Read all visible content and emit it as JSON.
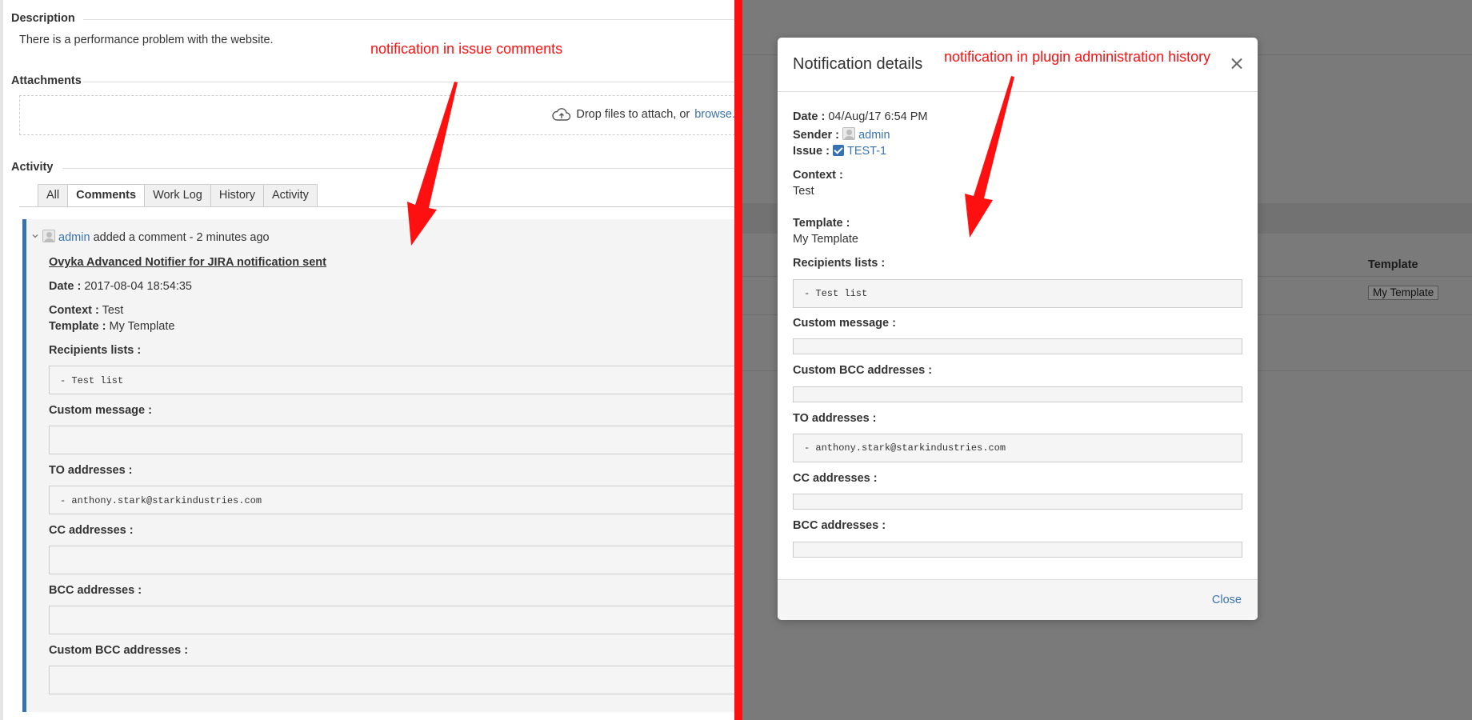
{
  "left_pane": {
    "description": {
      "heading": "Description",
      "text": "There is a performance problem with the website."
    },
    "attachments": {
      "heading": "Attachments",
      "drop_text": "Drop files to attach, or",
      "browse_link": "browse."
    },
    "activity": {
      "heading": "Activity",
      "tabs": [
        {
          "label": "All",
          "active": false
        },
        {
          "label": "Comments",
          "active": true
        },
        {
          "label": "Work Log",
          "active": false
        },
        {
          "label": "History",
          "active": false
        },
        {
          "label": "Activity",
          "active": false
        }
      ]
    },
    "comment": {
      "author": "admin",
      "action": "added a comment - 2 minutes ago",
      "title": "Ovyka Advanced Notifier for JIRA notification sent",
      "date_label": "Date :",
      "date_value": "2017-08-04 18:54:35",
      "context_label": "Context :",
      "context_value": "Test",
      "template_label": "Template :",
      "template_value": "My Template",
      "recipients_label": "Recipients lists :",
      "recipients_value": "- Test list",
      "custom_message_label": "Custom message :",
      "to_label": "TO addresses :",
      "to_value": "- anthony.stark@starkindustries.com",
      "cc_label": "CC addresses :",
      "bcc_label": "BCC addresses :",
      "custom_bcc_label": "Custom BCC addresses :"
    }
  },
  "right_pane": {
    "background_table": {
      "template_header": "Template",
      "template_value": "My Template"
    }
  },
  "dialog": {
    "title": "Notification details",
    "date_label": "Date :",
    "date_value": "04/Aug/17 6:54 PM",
    "sender_label": "Sender :",
    "sender_value": "admin",
    "issue_label": "Issue :",
    "issue_value": "TEST-1",
    "context_label": "Context :",
    "context_value": "Test",
    "template_label": "Template :",
    "template_value": "My Template",
    "recipients_label": "Recipients lists :",
    "recipients_value": "- Test list",
    "custom_message_label": "Custom message :",
    "custom_bcc_label": "Custom BCC addresses :",
    "to_label": "TO addresses :",
    "to_value": "- anthony.stark@starkindustries.com",
    "cc_label": "CC addresses :",
    "bcc_label": "BCC addresses :",
    "close_button": "Close"
  },
  "annotations": {
    "left": "notification in issue comments",
    "right": "notification in plugin administration history"
  },
  "colors": {
    "divider": "#ff1010",
    "annotation": "#ff1010",
    "comment_bar": "#3572b0",
    "link": "#3b73af"
  }
}
